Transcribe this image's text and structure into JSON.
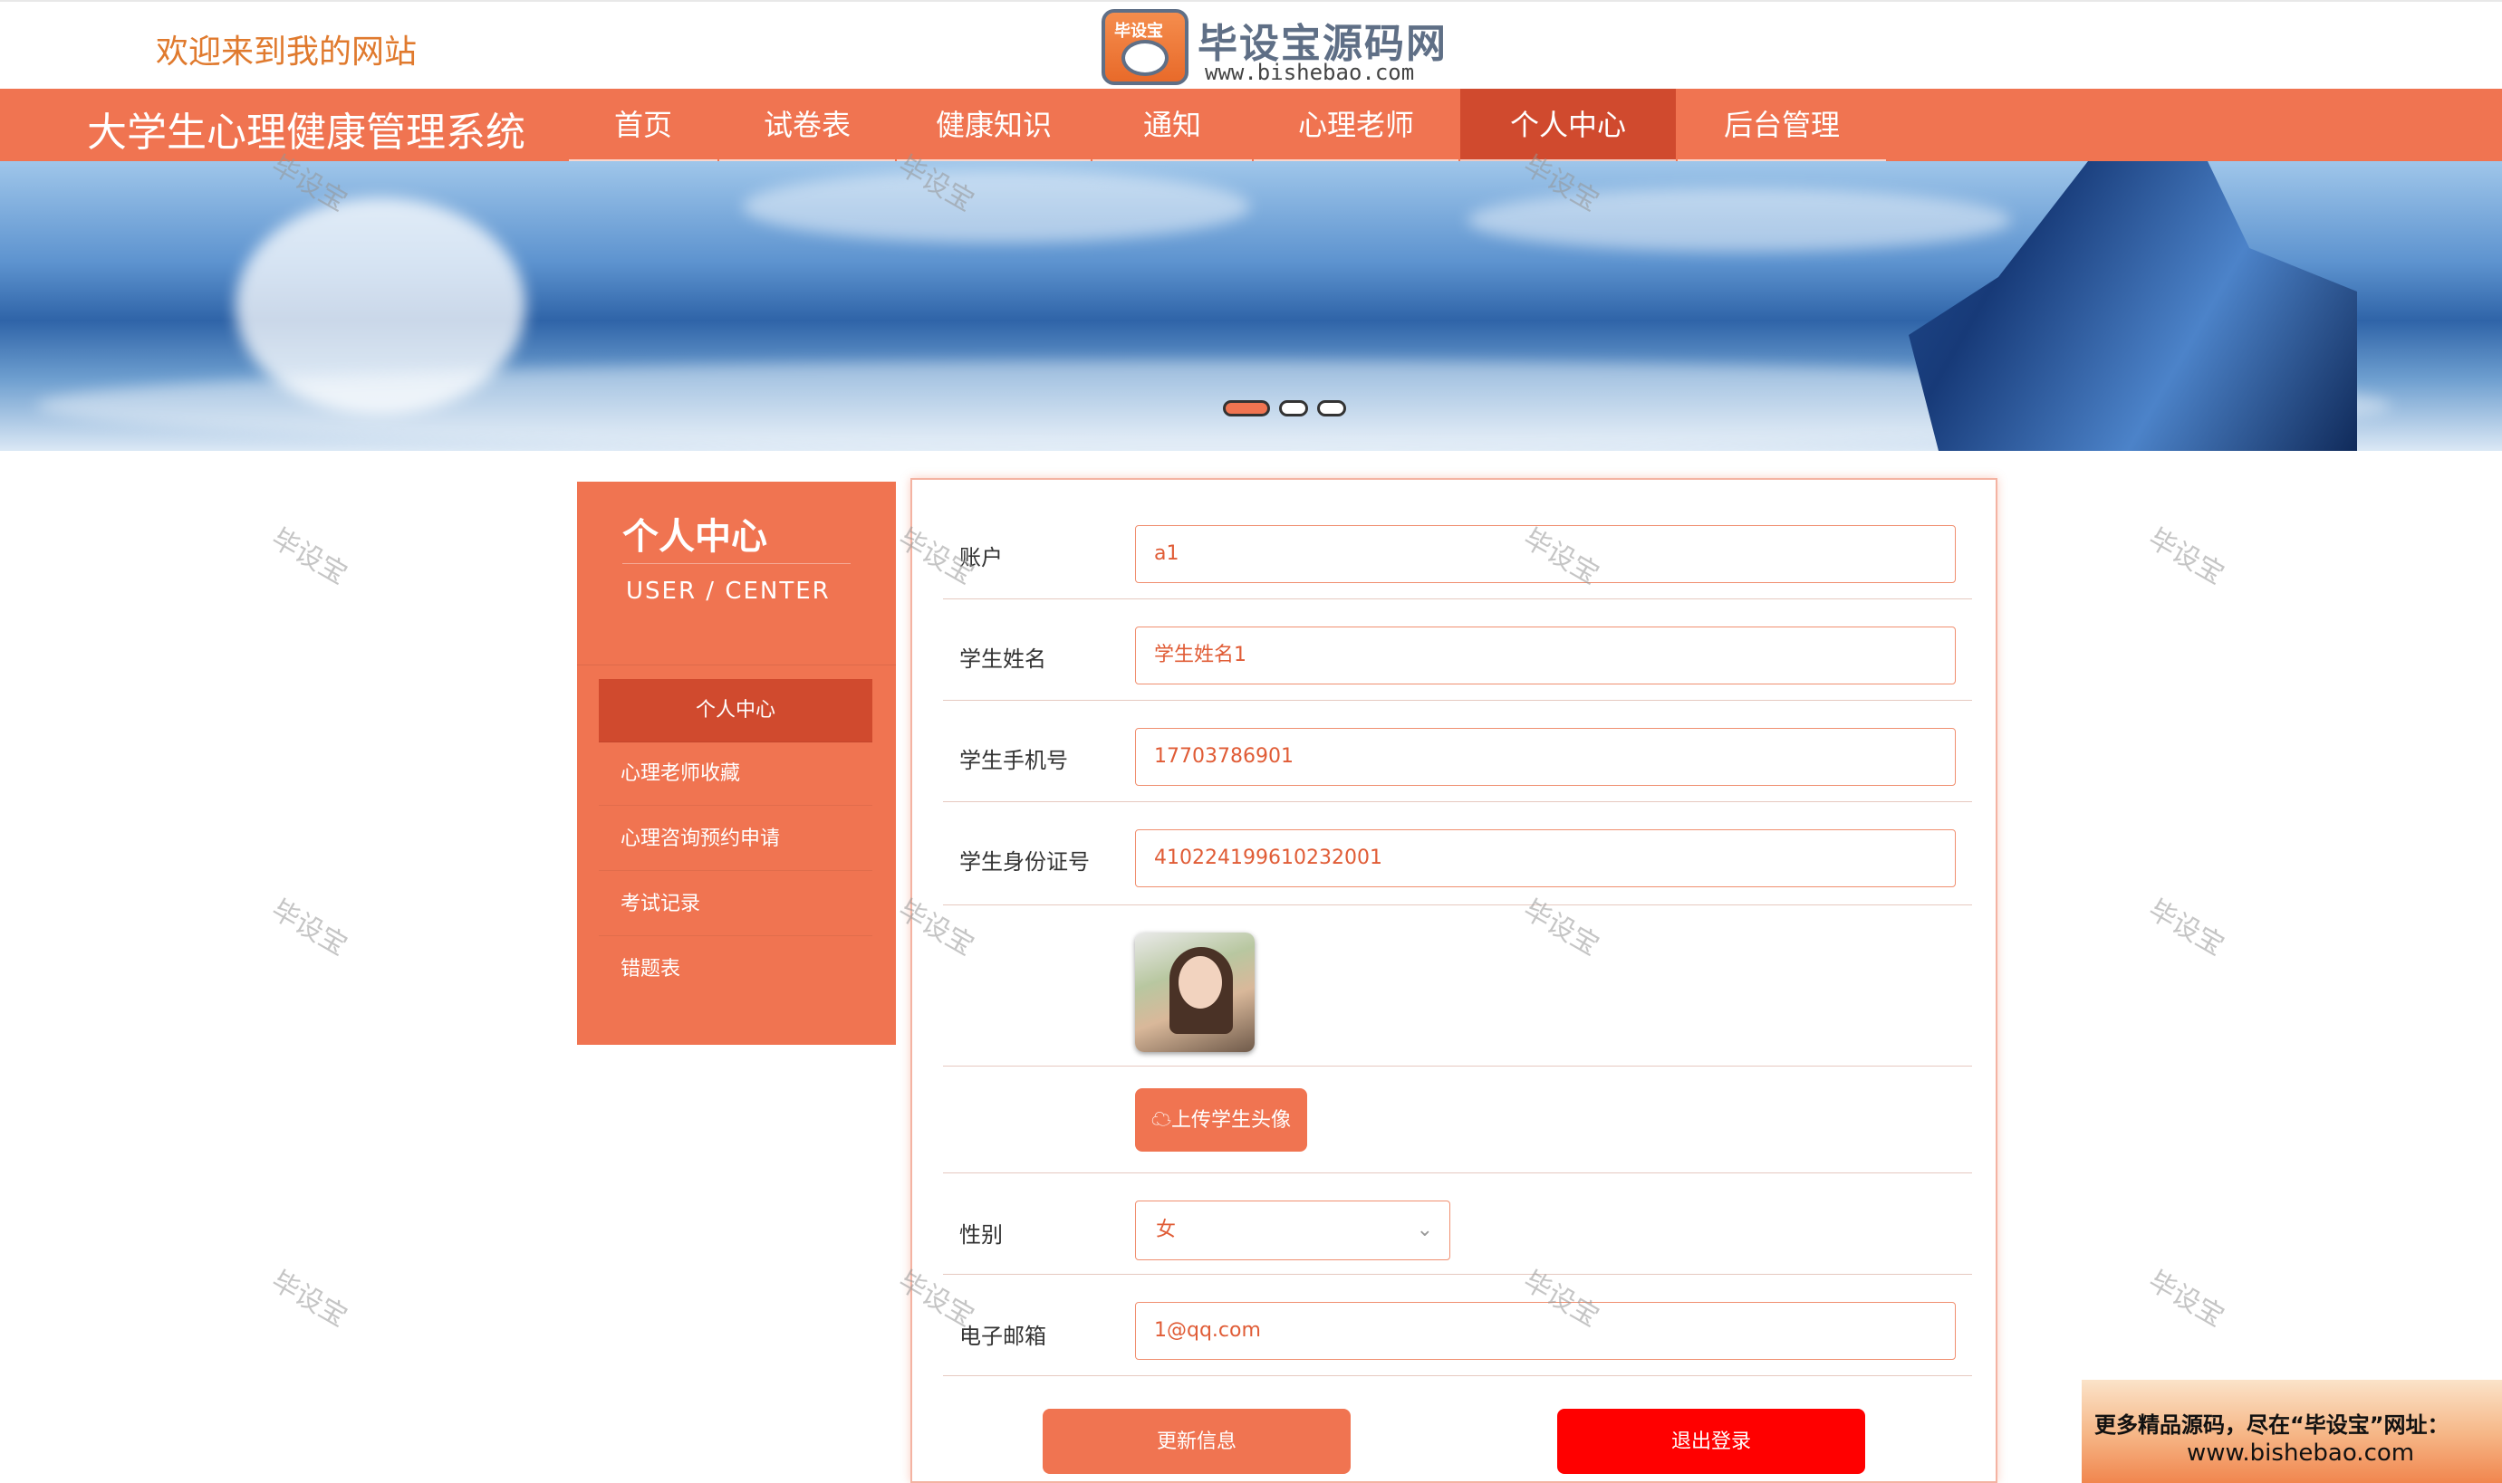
{
  "header": {
    "welcome": "欢迎来到我的网站",
    "logo_badge": "毕设宝",
    "logo_cn": "毕设宝源码网",
    "logo_en": "www.bishebao.com"
  },
  "nav": {
    "site_title": "大学生心理健康管理系统",
    "items": [
      "首页",
      "试卷表",
      "健康知识",
      "通知",
      "心理老师",
      "个人中心",
      "后台管理"
    ],
    "active": "个人中心"
  },
  "sidebar": {
    "title": "个人中心",
    "subtitle": "USER / CENTER",
    "items": [
      "个人中心",
      "心理老师收藏",
      "心理咨询预约申请",
      "考试记录",
      "错题表"
    ]
  },
  "form": {
    "account_label": "账户",
    "account_value": "a1",
    "name_label": "学生姓名",
    "name_value": "学生姓名1",
    "phone_label": "学生手机号",
    "phone_value": "17703786901",
    "idcard_label": "学生身份证号",
    "idcard_value": "410224199610232001",
    "upload_label": "上传学生头像",
    "gender_label": "性别",
    "gender_value": "女",
    "email_label": "电子邮箱",
    "email_value": "1@qq.com",
    "update_label": "更新信息",
    "logout_label": "退出登录"
  },
  "watermark": "毕设宝",
  "promo": {
    "line1": "更多精品源码，尽在“毕设宝”网址：",
    "line2": "www.bishebao.com"
  },
  "colors": {
    "accent": "#f07451",
    "accent_dark": "#d04a2e",
    "logout": "#ff0000",
    "welcome": "#e07a2e"
  }
}
